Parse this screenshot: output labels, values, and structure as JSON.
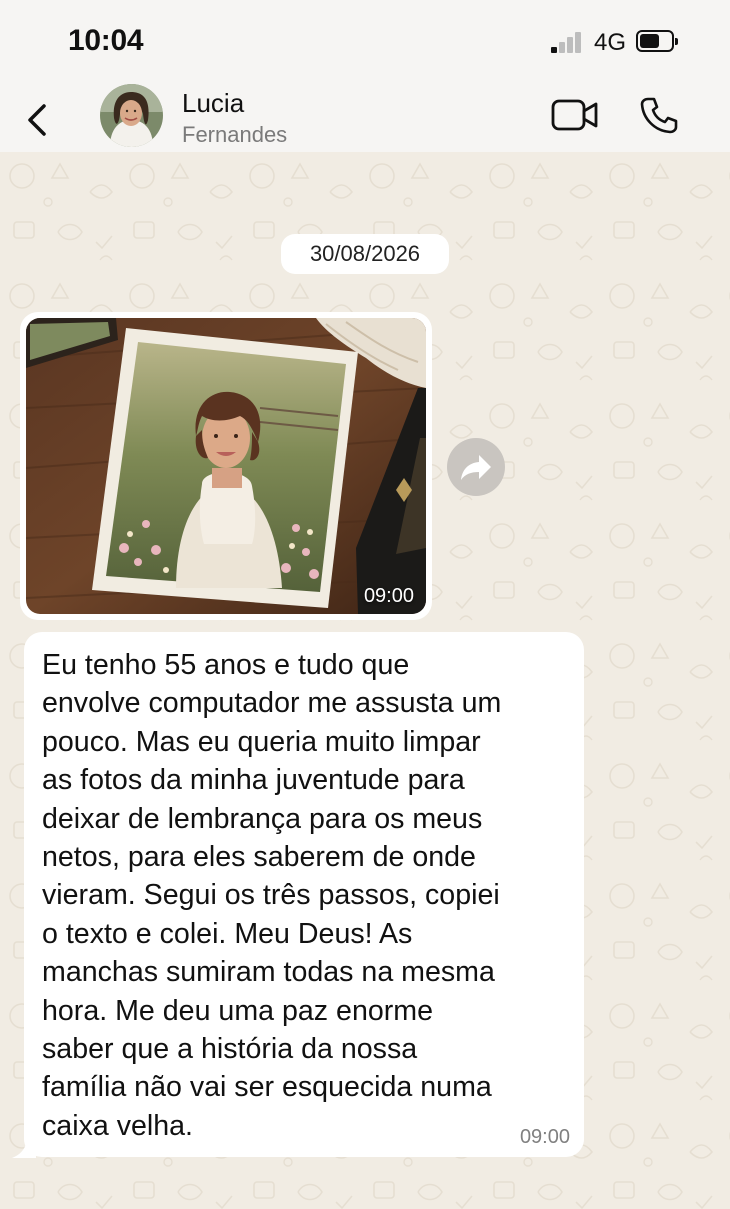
{
  "status_bar": {
    "time": "10:04",
    "network": "4G",
    "signal_bars_active": 1,
    "signal_bars_total": 4,
    "battery_level": 0.55
  },
  "header": {
    "contact_first_name": "Lucia",
    "contact_last_name": "Fernandes",
    "back_icon": "chevron-left-icon",
    "video_icon": "video-camera-icon",
    "call_icon": "phone-icon"
  },
  "chat": {
    "date_chip": "30/08/2026",
    "messages": [
      {
        "type": "image",
        "time": "09:00",
        "forward_icon": "forward-arrow-icon"
      },
      {
        "type": "text",
        "time": "09:00",
        "lines": [
          "Eu tenho 55 anos e tudo que",
          "envolve computador me assusta um",
          "pouco. Mas eu queria muito limpar",
          "as fotos da minha juventude para",
          "deixar de lembrança para os meus",
          "netos, para eles saberem de onde",
          "vieram. Segui os três passos, copiei",
          "o texto e colei. Meu Deus! As",
          "manchas sumiram todas na mesma",
          "hora. Me deu uma paz enorme",
          "saber que a história da nossa",
          "família não vai ser esquecida numa",
          "caixa velha."
        ]
      }
    ]
  },
  "colors": {
    "background": "#f1ece3",
    "bubble": "#ffffff",
    "header": "#f6f5f3",
    "text_primary": "#111111",
    "text_secondary": "#7a7a7a"
  }
}
